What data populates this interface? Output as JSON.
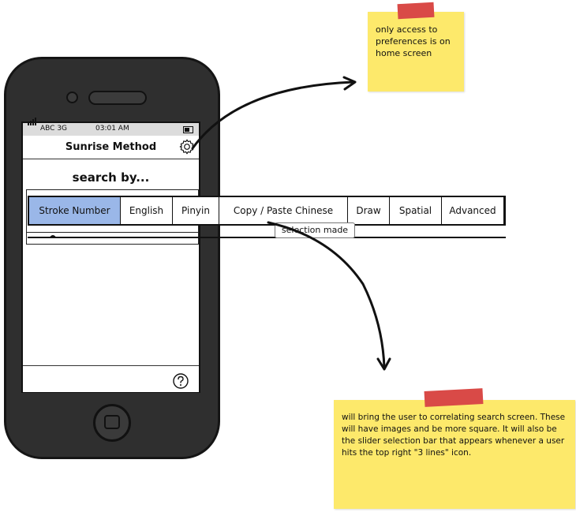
{
  "status": {
    "carrier": "ABC 3G",
    "time": "03:01 AM"
  },
  "nav": {
    "title": "Sunrise Method"
  },
  "search": {
    "title": "search by..."
  },
  "tabs": [
    {
      "label": "Stroke Number",
      "active": true
    },
    {
      "label": "English",
      "active": false
    },
    {
      "label": "Pinyin",
      "active": false
    },
    {
      "label": "Copy / Paste Chinese",
      "active": false
    },
    {
      "label": "Draw",
      "active": false
    },
    {
      "label": "Spatial",
      "active": false
    },
    {
      "label": "Advanced",
      "active": false
    }
  ],
  "tooltip": {
    "text": "selection made"
  },
  "notes": {
    "note1": "only access to preferences is on home screen",
    "note2": "will bring the user to correlating search screen. These will have images and be more square. It will also be the slider selection bar that appears whenever a user hits the top right \"3 lines\" icon."
  },
  "colors": {
    "active_tab": "#9ab7e8",
    "sticky_note": "#fde96b",
    "tape": "#d94a47",
    "phone_body": "#2f2f2f"
  },
  "icons": {
    "settings": "gear-icon",
    "help": "question-icon",
    "signal": "signal-icon",
    "battery": "battery-icon",
    "home": "home-button-icon"
  }
}
